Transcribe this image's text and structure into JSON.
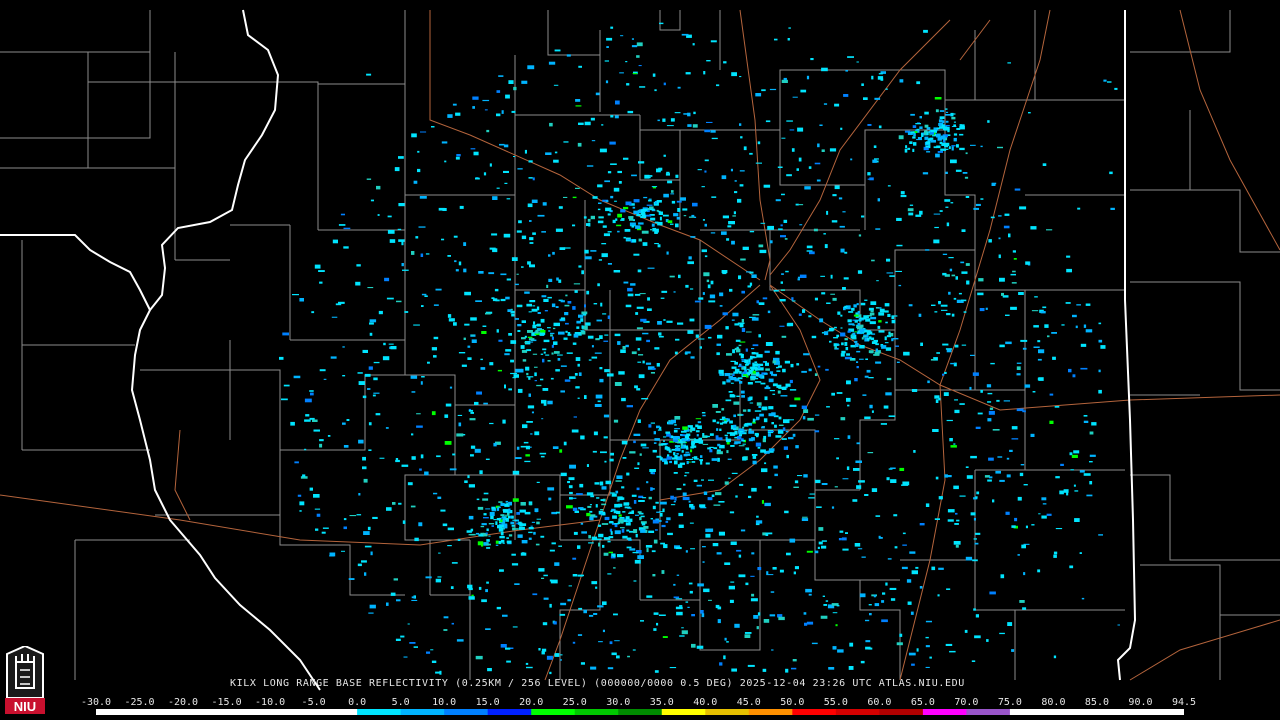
{
  "caption": "KILX LONG RANGE BASE REFLECTIVITY (0.25KM / 256 LEVEL) (000000/0000 0.5 DEG) 2025-12-04 23:26 UTC  ATLAS.NIU.EDU",
  "legend": {
    "labels": [
      "-30.0",
      "-25.0",
      "-20.0",
      "-15.0",
      "-10.0",
      "-5.0",
      "0.0",
      "5.0",
      "10.0",
      "15.0",
      "20.0",
      "25.0",
      "30.0",
      "35.0",
      "40.0",
      "45.0",
      "50.0",
      "55.0",
      "60.0",
      "65.0",
      "70.0",
      "75.0",
      "80.0",
      "85.0",
      "90.0",
      "94.5"
    ],
    "colors": [
      "#ffffff",
      "#ffffff",
      "#ffffff",
      "#ffffff",
      "#ffffff",
      "#ffffff",
      "#00e5ff",
      "#00b4ff",
      "#0080ff",
      "#0020ff",
      "#00ff00",
      "#00c800",
      "#008c00",
      "#ffff00",
      "#e6c000",
      "#ff9000",
      "#ff0000",
      "#d40000",
      "#b00000",
      "#ff00ff",
      "#9955c9",
      "#ffffff",
      "#ffffff",
      "#ffffff",
      "#ffffff"
    ]
  },
  "logo": {
    "text": "NIU",
    "color": "#c8102e"
  },
  "map": {
    "background": "#000000",
    "county_color": "#8c8c8c",
    "state_color": "#ffffff",
    "road_color": "#b4643c",
    "echo_colors": [
      "#00e5ff",
      "#00b4ff",
      "#0080ff",
      "#20d0c0",
      "#00ff00"
    ]
  }
}
